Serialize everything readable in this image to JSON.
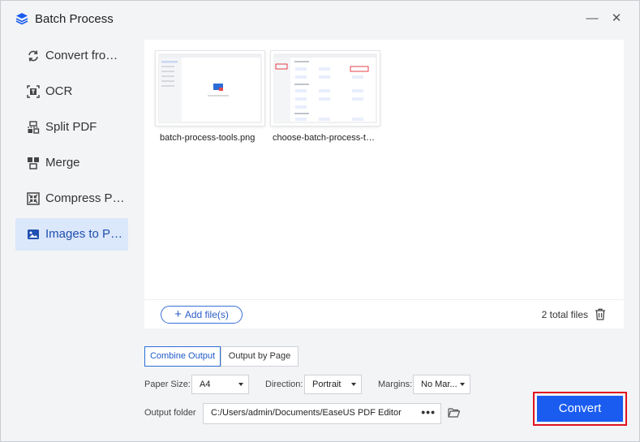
{
  "window": {
    "title": "Batch Process",
    "minimize_label": "—",
    "close_label": "✕"
  },
  "sidebar": {
    "items": [
      {
        "label": "Convert from PDF",
        "icon": "convert-icon"
      },
      {
        "label": "OCR",
        "icon": "ocr-icon"
      },
      {
        "label": "Split PDF",
        "icon": "split-icon"
      },
      {
        "label": "Merge",
        "icon": "merge-icon"
      },
      {
        "label": "Compress PDF",
        "icon": "compress-icon"
      },
      {
        "label": "Images to PDF",
        "icon": "image-icon",
        "active": true
      }
    ]
  },
  "files": [
    {
      "name": "batch-process-tools.png"
    },
    {
      "name": "choose-batch-process-tool.png"
    }
  ],
  "footer": {
    "add_files_label": "Add file(s)",
    "total_files": "2 total files"
  },
  "output_mode": {
    "combine_label": "Combine Output",
    "by_page_label": "Output by Page",
    "selected": "Combine Output"
  },
  "options": {
    "paper_size_label": "Paper Size:",
    "paper_size_value": "A4",
    "direction_label": "Direction:",
    "direction_value": "Portrait",
    "margins_label": "Margins:",
    "margins_value": "No Mar..."
  },
  "output_folder": {
    "label": "Output folder",
    "path": "C:/Users/admin/Documents/EaseUS PDF Editor",
    "browse_label": "•••"
  },
  "convert_label": "Convert",
  "colors": {
    "accent": "#1a5cf0",
    "active_bg": "#dbe7fa",
    "highlight_border": "#e0141e"
  }
}
